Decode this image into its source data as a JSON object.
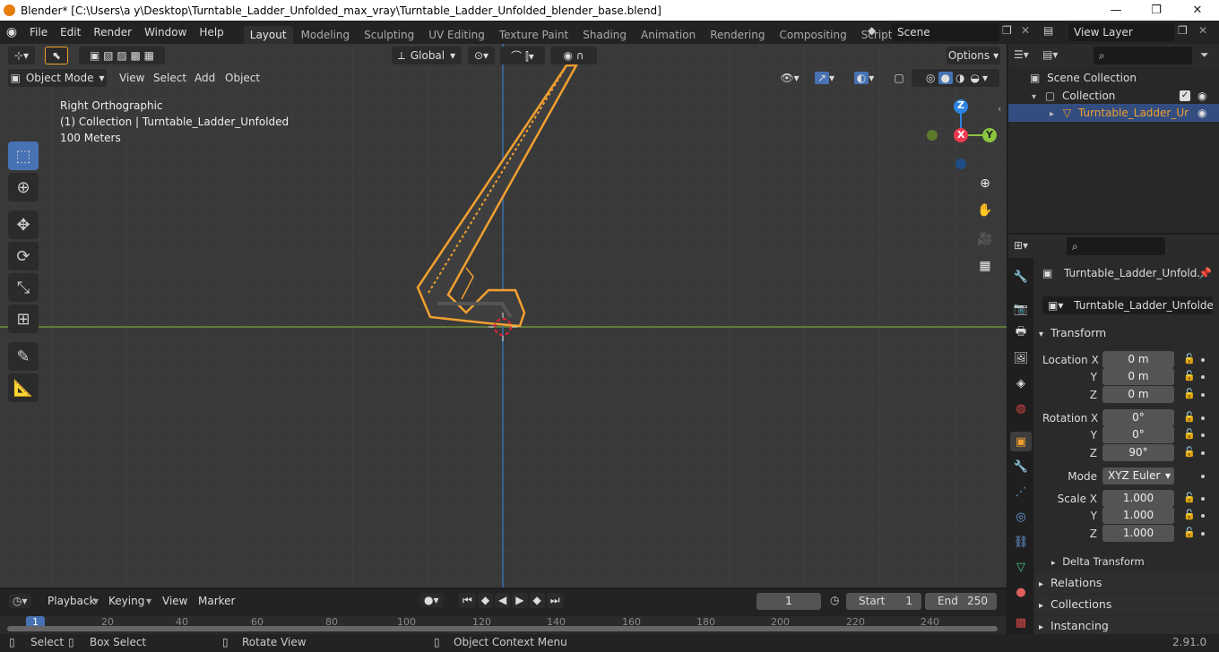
{
  "window": {
    "title": "Blender* [C:\\Users\\a y\\Desktop\\Turntable_Ladder_Unfolded_max_vray\\Turntable_Ladder_Unfolded_blender_base.blend]",
    "minimize": "—",
    "maximize": "❐",
    "close": "✕"
  },
  "menu": [
    "File",
    "Edit",
    "Render",
    "Window",
    "Help"
  ],
  "workspaces": [
    "Layout",
    "Modeling",
    "Sculpting",
    "UV Editing",
    "Texture Paint",
    "Shading",
    "Animation",
    "Rendering",
    "Compositing",
    "Scripting"
  ],
  "active_workspace": "Layout",
  "scene": {
    "name": "Scene",
    "view_layer": "View Layer"
  },
  "viewport_header": {
    "transform_orientation": "Global",
    "options": "Options",
    "mode": "Object Mode",
    "menus": [
      "View",
      "Select",
      "Add",
      "Object"
    ]
  },
  "viewport_info": {
    "view": "Right Orthographic",
    "collection": "(1) Collection | Turntable_Ladder_Unfolded",
    "scale": "100 Meters"
  },
  "gizmo": {
    "z": "Z",
    "x": "X",
    "y": "Y"
  },
  "outliner": {
    "scene_collection": "Scene Collection",
    "collection": "Collection",
    "object": "Turntable_Ladder_Ur"
  },
  "properties": {
    "object_name": "Turntable_Ladder_Unfold...",
    "object_field": "Turntable_Ladder_Unfolded",
    "transform_label": "Transform",
    "location": {
      "label": "Location X",
      "x": "0 m",
      "y": "0 m",
      "z": "0 m"
    },
    "rotation": {
      "label": "Rotation X",
      "x": "0°",
      "y": "0°",
      "z": "90°"
    },
    "mode": {
      "label": "Mode",
      "value": "XYZ Euler"
    },
    "scale": {
      "label": "Scale X",
      "x": "1.000",
      "y": "1.000",
      "z": "1.000"
    },
    "axis_y": "Y",
    "axis_z": "Z",
    "delta_transform": "Delta Transform",
    "relations": "Relations",
    "collections": "Collections",
    "instancing": "Instancing"
  },
  "timeline": {
    "menus": [
      "Playback",
      "Keying",
      "View",
      "Marker"
    ],
    "current_frame": "1",
    "start_label": "Start",
    "start": "1",
    "end_label": "End",
    "end": "250",
    "ruler": [
      "1",
      "20",
      "40",
      "60",
      "80",
      "100",
      "120",
      "140",
      "160",
      "180",
      "200",
      "220",
      "240"
    ]
  },
  "statusbar": {
    "select": "Select",
    "box_select": "Box Select",
    "rotate": "Rotate View",
    "context": "Object Context Menu",
    "version": "2.91.0"
  },
  "colors": {
    "accent": "#4772b3",
    "selection_orange": "#f0a030",
    "axis_x": "#f03a4f",
    "axis_y": "#8bc53f",
    "axis_z": "#2f84e3"
  }
}
